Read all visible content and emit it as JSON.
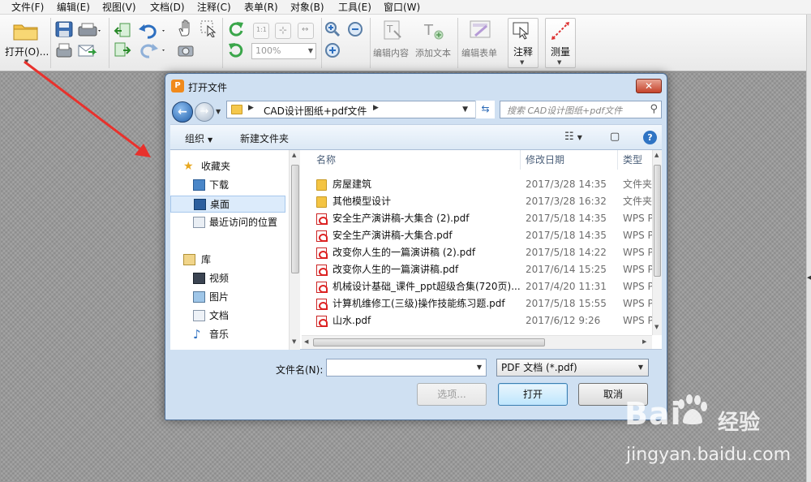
{
  "menu": [
    "文件(F)",
    "编辑(E)",
    "视图(V)",
    "文档(D)",
    "注释(C)",
    "表单(R)",
    "对象(B)",
    "工具(E)",
    "窗口(W)"
  ],
  "toolbar": {
    "open_label": "打开(O)...",
    "zoom_value": "100%",
    "edit_content": "编辑内容",
    "add_text": "添加文本",
    "edit_form": "编辑表单",
    "annotate": "注释",
    "measure": "测量"
  },
  "dialog": {
    "title": "打开文件",
    "close_glyph": "✕",
    "address": "CAD设计图纸+pdf文件",
    "search_placeholder": "搜索 CAD设计图纸+pdf文件",
    "organize": "组织",
    "new_folder": "新建文件夹",
    "nav": {
      "favorites": "收藏夹",
      "downloads": "下载",
      "desktop": "桌面",
      "recent": "最近访问的位置",
      "library": "库",
      "videos": "视频",
      "pictures": "图片",
      "documents": "文档",
      "music": "音乐"
    },
    "columns": {
      "name": "名称",
      "date": "修改日期",
      "type": "类型"
    },
    "files": [
      {
        "name": "房屋建筑",
        "date": "2017/3/28 14:35",
        "type": "文件夹",
        "kind": "folder"
      },
      {
        "name": "其他模型设计",
        "date": "2017/3/28 16:32",
        "type": "文件夹",
        "kind": "folder"
      },
      {
        "name": "安全生产演讲稿-大集合 (2).pdf",
        "date": "2017/5/18 14:35",
        "type": "WPS P",
        "kind": "pdf"
      },
      {
        "name": "安全生产演讲稿-大集合.pdf",
        "date": "2017/5/18 14:35",
        "type": "WPS P",
        "kind": "pdf"
      },
      {
        "name": "改变你人生的一篇演讲稿 (2).pdf",
        "date": "2017/5/18 14:22",
        "type": "WPS P",
        "kind": "pdf"
      },
      {
        "name": "改变你人生的一篇演讲稿.pdf",
        "date": "2017/6/14 15:25",
        "type": "WPS P",
        "kind": "pdf"
      },
      {
        "name": "机械设计基础_课件_ppt超级合集(720页)...",
        "date": "2017/4/20 11:31",
        "type": "WPS P",
        "kind": "pdf"
      },
      {
        "name": "计算机维修工(三级)操作技能练习题.pdf",
        "date": "2017/5/18 15:55",
        "type": "WPS P",
        "kind": "pdf"
      },
      {
        "name": "山水.pdf",
        "date": "2017/6/12 9:26",
        "type": "WPS P",
        "kind": "pdf"
      }
    ],
    "filename_label": "文件名(N):",
    "filename_value": "",
    "filetype": "PDF 文档 (*.pdf)",
    "btn_options": "选项...",
    "btn_open": "打开",
    "btn_cancel": "取消"
  },
  "watermark": {
    "logo": "Bai",
    "logo_cn": "经验",
    "url": "jingyan.baidu.com"
  }
}
